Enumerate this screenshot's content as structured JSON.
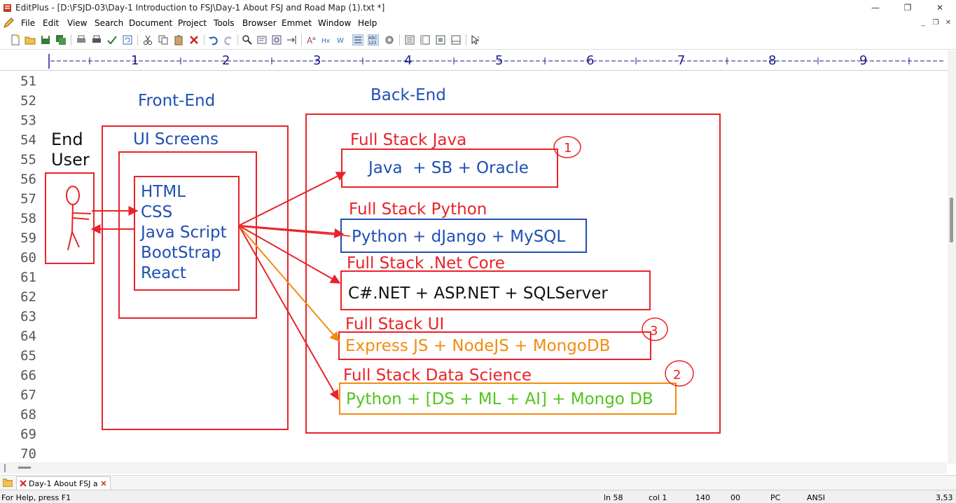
{
  "window": {
    "title": "EditPlus - [D:\\FSJD-03\\Day-1 Introduction to FSJ\\Day-1 About FSJ and Road Map (1).txt *]",
    "minimize_glyph": "—",
    "maximize_glyph": "❐",
    "close_glyph": "✕"
  },
  "menu": [
    "File",
    "Edit",
    "View",
    "Search",
    "Document",
    "Project",
    "Tools",
    "Browser",
    "Emmet",
    "Window",
    "Help"
  ],
  "mdi": {
    "minimize": "_",
    "restore": "❐",
    "close": "✕"
  },
  "ruler": {
    "marks": [
      "1",
      "2",
      "3",
      "4",
      "5",
      "6",
      "7",
      "8",
      "9"
    ]
  },
  "editor": {
    "line_numbers": [
      "51",
      "52",
      "53",
      "54",
      "55",
      "56",
      "57",
      "58",
      "59",
      "60",
      "61",
      "62",
      "63",
      "64",
      "65",
      "66",
      "67",
      "68",
      "69",
      "70"
    ],
    "diagram": {
      "front_end_heading": "Front-End",
      "back_end_heading": "Back-End",
      "end_user_line1": "End",
      "end_user_line2": "User",
      "ui_screens": "UI Screens",
      "frontend_tech": [
        "HTML",
        "CSS",
        "Java Script",
        "BootStrap",
        "React"
      ],
      "stacks": [
        {
          "title": "Full Stack Java",
          "content": "Java  + SB + Oracle"
        },
        {
          "title": "Full Stack Python",
          "content": "Python + dJango + MySQL"
        },
        {
          "title": "Full Stack .Net Core",
          "content": "C#.NET + ASP.NET + SQLServer"
        },
        {
          "title": "Full Stack UI",
          "content": "Express JS + NodeJS + MongoDB"
        },
        {
          "title": "Full Stack Data Science",
          "content": "Python + [DS + ML + AI] + Mongo DB"
        }
      ],
      "annotations": [
        "1",
        "3",
        "2"
      ],
      "colors": {
        "red": "#e8232a",
        "blue": "#1f4fb4",
        "orange": "#f28c0f",
        "green": "#52c41a",
        "black": "#111111"
      }
    }
  },
  "tab": {
    "label": "Day-1 About FSJ a"
  },
  "status": {
    "help": "For Help, press F1",
    "line": "ln 58",
    "col": "col 1",
    "width": "140",
    "code": "00",
    "mode": "PC",
    "encoding": "ANSI",
    "size": "3,53"
  }
}
